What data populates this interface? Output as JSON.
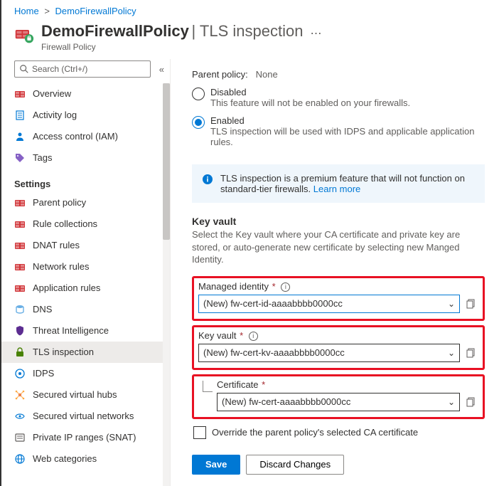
{
  "breadcrumb": {
    "home": "Home",
    "current": "DemoFirewallPolicy"
  },
  "header": {
    "title": "DemoFirewallPolicy",
    "subtitle": "TLS inspection",
    "caption": "Firewall Policy",
    "more": "⋯"
  },
  "search": {
    "placeholder": "Search (Ctrl+/)",
    "collapse": "«"
  },
  "nav": {
    "top": [
      {
        "key": "overview",
        "label": "Overview",
        "icon": "firewall"
      },
      {
        "key": "activity-log",
        "label": "Activity log",
        "icon": "log"
      },
      {
        "key": "access-control",
        "label": "Access control (IAM)",
        "icon": "person"
      },
      {
        "key": "tags",
        "label": "Tags",
        "icon": "tag"
      }
    ],
    "settings_header": "Settings",
    "settings": [
      {
        "key": "parent-policy",
        "label": "Parent policy",
        "icon": "firewall"
      },
      {
        "key": "rule-collections",
        "label": "Rule collections",
        "icon": "firewall"
      },
      {
        "key": "dnat-rules",
        "label": "DNAT rules",
        "icon": "firewall"
      },
      {
        "key": "network-rules",
        "label": "Network rules",
        "icon": "firewall"
      },
      {
        "key": "application-rules",
        "label": "Application rules",
        "icon": "firewall"
      },
      {
        "key": "dns",
        "label": "DNS",
        "icon": "dns"
      },
      {
        "key": "threat-intelligence",
        "label": "Threat Intelligence",
        "icon": "shield"
      },
      {
        "key": "tls-inspection",
        "label": "TLS inspection",
        "icon": "lock",
        "selected": true
      },
      {
        "key": "idps",
        "label": "IDPS",
        "icon": "idps"
      },
      {
        "key": "secured-virtual-hubs",
        "label": "Secured virtual hubs",
        "icon": "hub"
      },
      {
        "key": "secured-virtual-networks",
        "label": "Secured virtual networks",
        "icon": "vnet"
      },
      {
        "key": "private-ip-ranges",
        "label": "Private IP ranges (SNAT)",
        "icon": "ip"
      },
      {
        "key": "web-categories",
        "label": "Web categories",
        "icon": "globe"
      }
    ]
  },
  "main": {
    "parent_policy_label": "Parent policy:",
    "parent_policy_value": "None",
    "disabled_label": "Disabled",
    "disabled_desc": "This feature will not be enabled on your firewalls.",
    "enabled_label": "Enabled",
    "enabled_desc": "TLS inspection will be used with IDPS and applicable application rules.",
    "info_text": "TLS inspection is a premium feature that will not function on standard-tier firewalls.",
    "info_link": "Learn more",
    "kv_title": "Key vault",
    "kv_desc": "Select the Key vault where your CA certificate and private key are stored, or auto-generate new certificate by selecting new Manged Identity.",
    "managed_identity_label": "Managed identity",
    "managed_identity_value": "(New) fw-cert-id-aaaabbbb0000cc",
    "key_vault_label": "Key vault",
    "key_vault_value": "(New) fw-cert-kv-aaaabbbb0000cc",
    "certificate_label": "Certificate",
    "certificate_value": "(New) fw-cert-aaaabbbb0000cc",
    "override_label": "Override the parent policy's selected CA certificate",
    "save": "Save",
    "discard": "Discard Changes"
  }
}
